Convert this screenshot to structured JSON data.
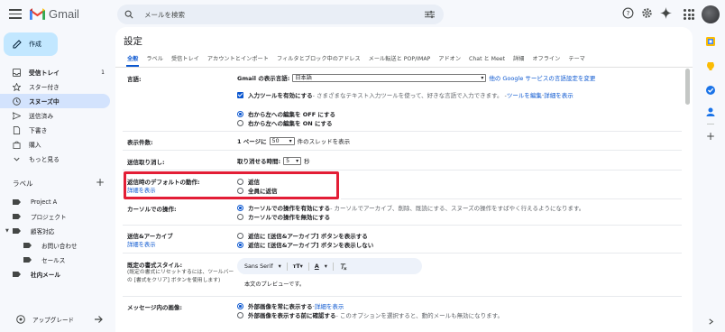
{
  "app": {
    "logo_text": "Gmail",
    "search_placeholder": "メールを検索"
  },
  "top_icons": [
    "help-icon",
    "gear-icon",
    "gemini-sparkle-icon",
    "apps-grid-icon",
    "avatar"
  ],
  "sidebar": {
    "compose_label": "作成",
    "items": [
      {
        "label": "受信トレイ",
        "count": "1",
        "icon": "inbox-icon",
        "bold": true
      },
      {
        "label": "スター付き",
        "icon": "star-icon"
      },
      {
        "label": "スヌーズ中",
        "icon": "clock-icon",
        "active": true
      },
      {
        "label": "送信済み",
        "icon": "send-icon"
      },
      {
        "label": "下書き",
        "icon": "draft-icon"
      },
      {
        "label": "購入",
        "icon": "purchase-icon"
      },
      {
        "label": "もっと見る",
        "icon": "chevron-down-icon"
      }
    ],
    "labels_heading": "ラベル",
    "labels": [
      {
        "label": "Project A"
      },
      {
        "label": "プロジェクト"
      },
      {
        "label": "顧客対応",
        "expanded": true
      },
      {
        "label": "お問い合わせ",
        "sub": true
      },
      {
        "label": "セールス",
        "sub": true
      },
      {
        "label": "社内メール",
        "bold": true
      }
    ],
    "upgrade_label": "アップグレード"
  },
  "settings": {
    "title": "設定",
    "tabs": [
      "全般",
      "ラベル",
      "受信トレイ",
      "アカウントとインポート",
      "フィルタとブロック中のアドレス",
      "メール転送と POP/IMAP",
      "アドオン",
      "Chat と Meet",
      "詳細",
      "オフライン",
      "テーマ"
    ],
    "active_tab": "全般",
    "language": {
      "label": "言語:",
      "display_language_prefix": "Gmail の表示言語:",
      "display_language_value": "日本語",
      "other_lang_link": "他の Google サービスの言語設定を変更",
      "input_tools_label": "入力ツールを有効にする",
      "input_tools_desc": " - さまざまなテキスト入力ツールを使って、好きな言語で入力できます。 - ",
      "edit_tools_link": "ツールを編集",
      "dash": " - ",
      "details_link": "詳細を表示",
      "rtl_off": "右から左への編集を OFF にする",
      "rtl_on": "右から左への編集を ON にする"
    },
    "page_size": {
      "label": "表示件数:",
      "prefix": "1 ページに",
      "value": "50",
      "suffix": "件のスレッドを表示"
    },
    "undo_send": {
      "label": "送信取り消し:",
      "prefix": "取り消せる時間:",
      "value": "5",
      "suffix": "秒"
    },
    "reply_default": {
      "label": "返信時のデフォルトの動作:",
      "link": "詳細を表示",
      "opt1": "返信",
      "opt2": "全員に返信"
    },
    "cursor": {
      "label": "カーソルでの操作:",
      "opt1_bold": "カーソルでの操作を有効にする",
      "opt1_desc": " - カーソルでアーカイブ、削除、既読にする、スヌーズの操作をすばやく行えるようになります。",
      "opt2": "カーソルでの操作を無効にする"
    },
    "send_archive": {
      "label": "送信&アーカイブ",
      "link": "詳細を表示",
      "opt1": "返信に [送信&アーカイブ] ボタンを表示する",
      "opt2": "返信に [送信&アーカイブ] ボタンを表示しない"
    },
    "text_style": {
      "label": "既定の書式スタイル:",
      "note1": "(既定の書式にリセットするには、ツールバー",
      "note2": "の [書式をクリア] ボタンを使用します)",
      "font": "Sans Serif",
      "preview": "本文のプレビューです。"
    },
    "images": {
      "label": "メッセージ内の画像:",
      "opt1_bold": "外部画像を常に表示する",
      "opt1_dash": " - ",
      "opt1_link": "詳細を表示",
      "opt2_bold": "外部画像を表示する前に確認する",
      "opt2_desc": " - このオプションを選択すると、動的メールも無効になります。"
    }
  },
  "colors": {
    "accent": "#0b57d0",
    "highlight_box": "#e31e36",
    "compose_bg": "#c2e7ff",
    "active_nav_bg": "#d3e3fd"
  }
}
